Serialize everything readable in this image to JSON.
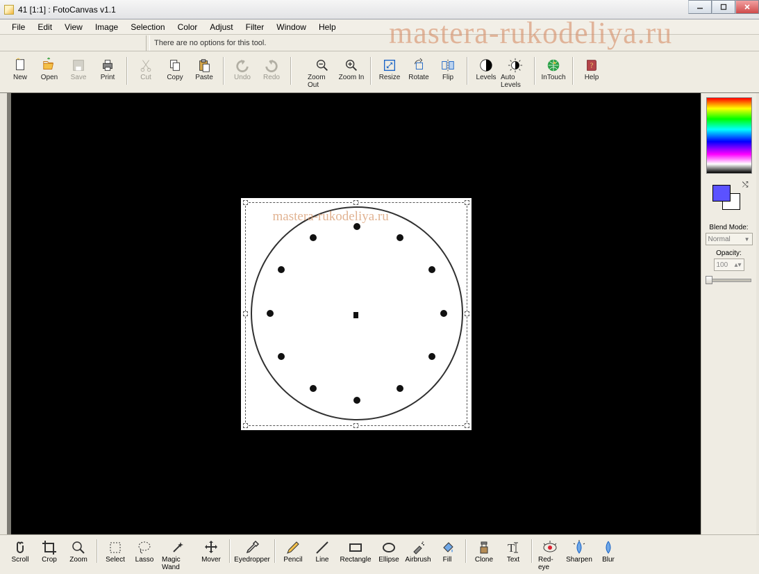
{
  "title": "41 [1:1] : FotoCanvas v1.1",
  "menu": [
    "File",
    "Edit",
    "View",
    "Image",
    "Selection",
    "Color",
    "Adjust",
    "Filter",
    "Window",
    "Help"
  ],
  "opts_text": "There are no options for this tool.",
  "toolbar": [
    {
      "name": "new",
      "label": "New"
    },
    {
      "name": "open",
      "label": "Open"
    },
    {
      "name": "save",
      "label": "Save",
      "dim": true
    },
    {
      "name": "print",
      "label": "Print"
    },
    {
      "sep": true
    },
    {
      "name": "cut",
      "label": "Cut",
      "dim": true
    },
    {
      "name": "copy",
      "label": "Copy"
    },
    {
      "name": "paste",
      "label": "Paste"
    },
    {
      "sep": true
    },
    {
      "name": "undo",
      "label": "Undo",
      "dim": true
    },
    {
      "name": "redo",
      "label": "Redo",
      "dim": true
    },
    {
      "sep": true
    },
    {
      "spacer": true
    },
    {
      "name": "zoomout",
      "label": "Zoom Out"
    },
    {
      "name": "zoomin",
      "label": "Zoom In"
    },
    {
      "sep": true
    },
    {
      "name": "resize",
      "label": "Resize"
    },
    {
      "name": "rotate",
      "label": "Rotate"
    },
    {
      "name": "flip",
      "label": "Flip"
    },
    {
      "sep": true
    },
    {
      "name": "levels",
      "label": "Levels"
    },
    {
      "name": "autolevels",
      "label": "Auto Levels"
    },
    {
      "sep": true
    },
    {
      "name": "intouch",
      "label": "InTouch"
    },
    {
      "sep": true
    },
    {
      "name": "help",
      "label": "Help"
    }
  ],
  "right": {
    "blend_label": "Blend Mode:",
    "blend_value": "Normal",
    "opacity_label": "Opacity:",
    "opacity_value": "100"
  },
  "bottombar": [
    {
      "name": "scroll",
      "label": "Scroll"
    },
    {
      "name": "crop",
      "label": "Crop"
    },
    {
      "name": "zoom",
      "label": "Zoom"
    },
    {
      "sep": true
    },
    {
      "name": "select",
      "label": "Select"
    },
    {
      "name": "lasso",
      "label": "Lasso"
    },
    {
      "name": "magicwand",
      "label": "Magic Wand",
      "wide": true
    },
    {
      "name": "mover",
      "label": "Mover"
    },
    {
      "sep": true
    },
    {
      "name": "eyedropper",
      "label": "Eyedropper",
      "wide": true
    },
    {
      "sep": true
    },
    {
      "name": "pencil",
      "label": "Pencil"
    },
    {
      "name": "line",
      "label": "Line"
    },
    {
      "name": "rectangle",
      "label": "Rectangle",
      "wide": true
    },
    {
      "name": "ellipse",
      "label": "Ellipse"
    },
    {
      "name": "airbrush",
      "label": "Airbrush"
    },
    {
      "name": "fill",
      "label": "Fill"
    },
    {
      "sep": true
    },
    {
      "name": "clone",
      "label": "Clone"
    },
    {
      "name": "text",
      "label": "Text"
    },
    {
      "sep": true
    },
    {
      "name": "redeye",
      "label": "Red-eye"
    },
    {
      "name": "sharpen",
      "label": "Sharpen"
    },
    {
      "name": "blur",
      "label": "Blur"
    }
  ],
  "watermark": "mastera-rukodeliya.ru"
}
